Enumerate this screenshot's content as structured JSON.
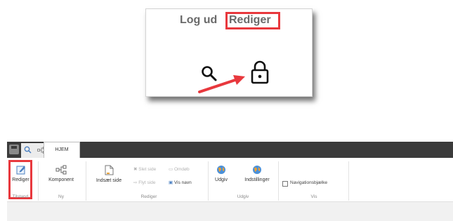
{
  "callout": {
    "logout_label": "Log ud",
    "edit_label": "Rediger",
    "icons": [
      "search-icon",
      "lock-icon",
      "arrow-icon"
    ],
    "highlight_color": "#e8383d"
  },
  "ribbon": {
    "tab_home": "HJEM",
    "groups": {
      "tilstand": {
        "label": "Tilstand",
        "rediger": "Rediger"
      },
      "ny": {
        "label": "Ny",
        "komponent": "Komponent"
      },
      "rediger": {
        "label": "Rediger",
        "indsaet_side": "Indsæt side",
        "slet_side": "Slet side",
        "omdob": "Omdøb",
        "flyt_side": "Flyt side",
        "vis_navn": "Vis navn"
      },
      "udgiv": {
        "label": "Udgiv",
        "udgiv": "Udgiv",
        "indstillinger": "Indstillinger"
      },
      "vis": {
        "label": "Vis",
        "navigationsbjaelke": "Navigationsbjælke"
      }
    }
  }
}
